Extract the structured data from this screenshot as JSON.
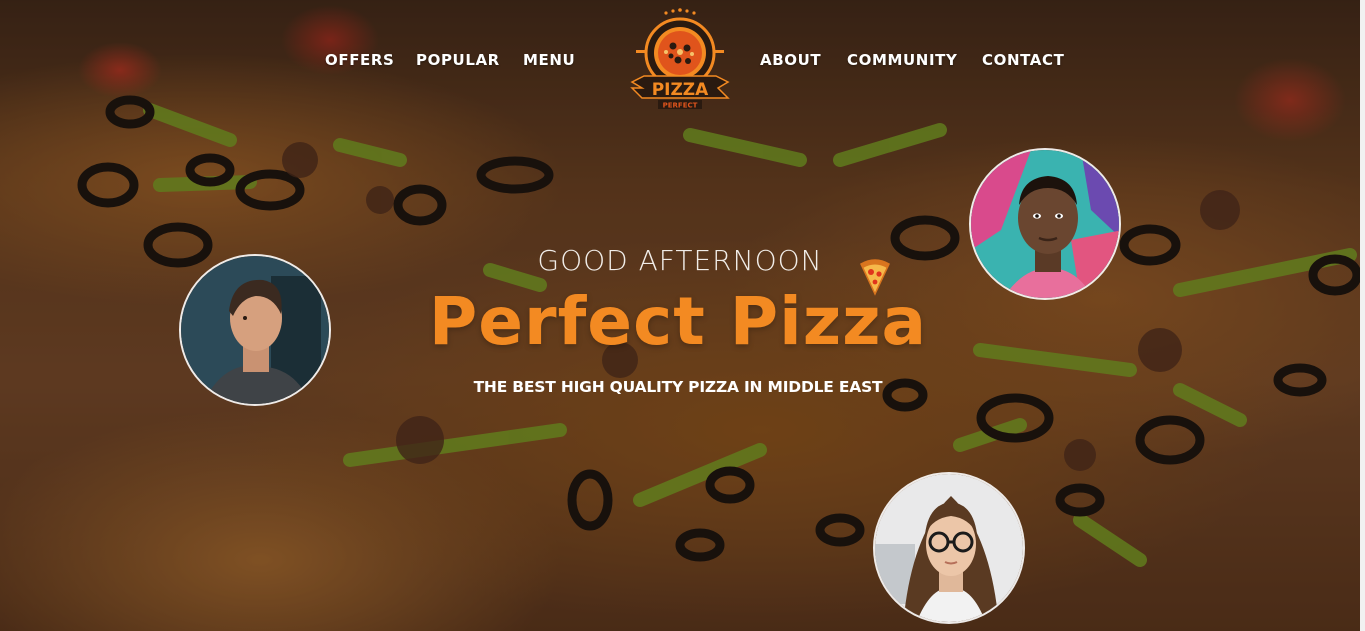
{
  "nav": {
    "left": [
      "OFFERS",
      "POPULAR",
      "MENU"
    ],
    "right": [
      "ABOUT",
      "COMMUNITY",
      "CONTACT"
    ]
  },
  "logo": {
    "text": "PIZZA",
    "subtext": "PERFECT"
  },
  "hero": {
    "greeting": "GOOD AFTERNOON",
    "title": "Perfect Pizza",
    "tagline": "THE BEST HIGH QUALITY PIZZA IN MIDDLE EAST"
  },
  "colors": {
    "accent": "#f38a22",
    "text": "#ffffff"
  },
  "icons": [
    "pizza-slice-icon"
  ]
}
